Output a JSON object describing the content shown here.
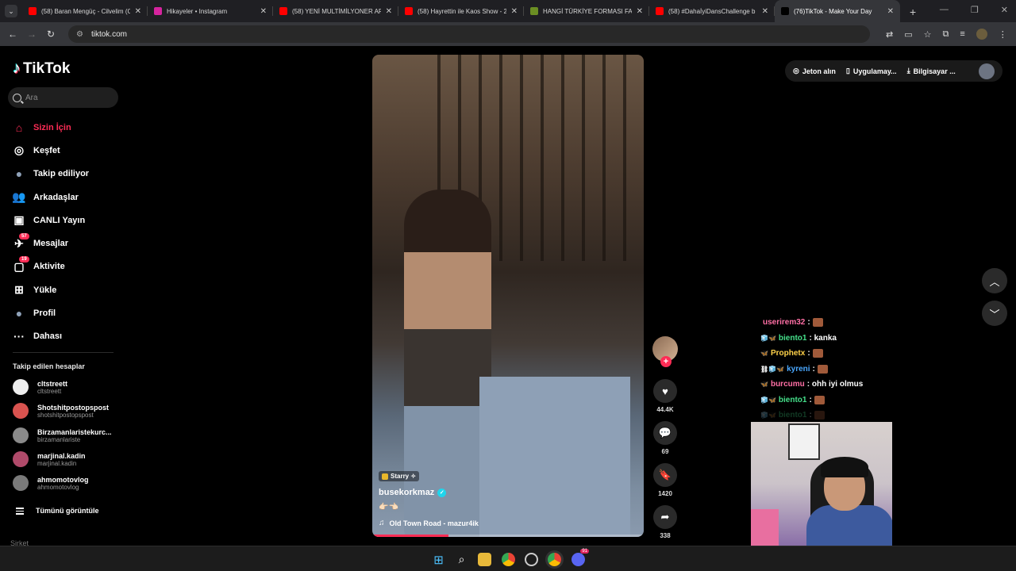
{
  "browser": {
    "tabs": [
      {
        "title": "(58) Baran Mengüç - Cilvelim (C",
        "color": "#ff0000",
        "icon": "youtube-icon"
      },
      {
        "title": "Hikayeler • Instagram",
        "color": "#d6249f",
        "icon": "instagram-icon"
      },
      {
        "title": "(58) YENİ MULTİMİLYONER ARA",
        "color": "#ff0000",
        "icon": "youtube-icon"
      },
      {
        "title": "(58) Hayrettin ile Kaos Show - 2",
        "color": "#ff0000",
        "icon": "youtube-icon"
      },
      {
        "title": "HANGİ TÜRKİYE FORMASI FAV",
        "color": "#6b8e23",
        "icon": "site-icon"
      },
      {
        "title": "(58) #DahaİyiDansChallenge b",
        "color": "#ff0000",
        "icon": "youtube-icon"
      },
      {
        "title": "(76)TikTok - Make Your Day",
        "color": "#000000",
        "icon": "tiktok-icon",
        "active": true
      }
    ],
    "url": "tiktok.com"
  },
  "sidebar": {
    "brand": "TikTok",
    "search_placeholder": "Ara",
    "nav": [
      {
        "label": "Sizin İçin",
        "icon": "home-icon",
        "active": true
      },
      {
        "label": "Keşfet",
        "icon": "compass-icon"
      },
      {
        "label": "Takip ediliyor",
        "icon": "following-avatar-icon"
      },
      {
        "label": "Arkadaşlar",
        "icon": "friends-icon"
      },
      {
        "label": "CANLI Yayın",
        "icon": "live-icon"
      },
      {
        "label": "Mesajlar",
        "icon": "messages-icon",
        "badge": "57"
      },
      {
        "label": "Aktivite",
        "icon": "activity-icon",
        "badge": "19"
      },
      {
        "label": "Yükle",
        "icon": "upload-icon"
      },
      {
        "label": "Profil",
        "icon": "profile-icon"
      },
      {
        "label": "Dahası",
        "icon": "more-icon"
      }
    ],
    "following_heading": "Takip edilen hesaplar",
    "accounts": [
      {
        "name": "cltstreett",
        "handle": "cltstreett",
        "color": "#eeeeee"
      },
      {
        "name": "Shotshitpostopspost",
        "handle": "shotshitpostopspost",
        "color": "#d9534f"
      },
      {
        "name": "Birzamanlaristekurc...",
        "handle": "birzamanlariste",
        "color": "#8a8a8a"
      },
      {
        "name": "marjinal.kadin",
        "handle": "marjinal.kadin",
        "color": "#b04a6a"
      },
      {
        "name": "ahmomotovlog",
        "handle": "ahmomotovlog",
        "color": "#7a7a7a"
      }
    ],
    "see_all": "Tümünü görüntüle",
    "company": "Şirket"
  },
  "video": {
    "sticker": "Starry ✧",
    "username": "busekorkmaz",
    "description": "👉🏻👈🏻",
    "music": "Old Town Road - mazur4ik",
    "likes": "44.4K",
    "comments": "69",
    "saves": "1420",
    "shares": "338"
  },
  "topbar": {
    "coins": "Jeton alın",
    "app": "Uygulamay...",
    "computer": "Bilgisayar ..."
  },
  "chat": [
    {
      "user": "userirem32",
      "color": "#ff6fa5",
      "msg": ":",
      "emote": true,
      "badges": ""
    },
    {
      "user": "biento1",
      "color": "#45e08a",
      "msg": ": kanka",
      "emote": false,
      "badges": "🧊🦋"
    },
    {
      "user": "Prophetx",
      "color": "#ffd24a",
      "msg": ":",
      "emote": true,
      "badges": "🦋"
    },
    {
      "user": "kyreni",
      "color": "#4aa8ff",
      "msg": ":",
      "emote": true,
      "badges": "⛓🧊🦋"
    },
    {
      "user": "burcumu",
      "color": "#ff6fa5",
      "msg": ": ohh iyi olmus",
      "emote": false,
      "badges": "🦋"
    },
    {
      "user": "biento1",
      "color": "#45e08a",
      "msg": ":",
      "emote": true,
      "badges": "🧊🦋"
    },
    {
      "user": "biento1",
      "color": "#45e08a",
      "msg": ":",
      "emote": true,
      "badges": "🧊🦋",
      "fade": true
    }
  ],
  "taskbar": {
    "icons": [
      "windows-start-icon",
      "search-icon",
      "file-explorer-icon",
      "chrome-icon",
      "steam-icon",
      "chrome-active-icon",
      "discord-icon"
    ],
    "discord_badge": "91"
  }
}
